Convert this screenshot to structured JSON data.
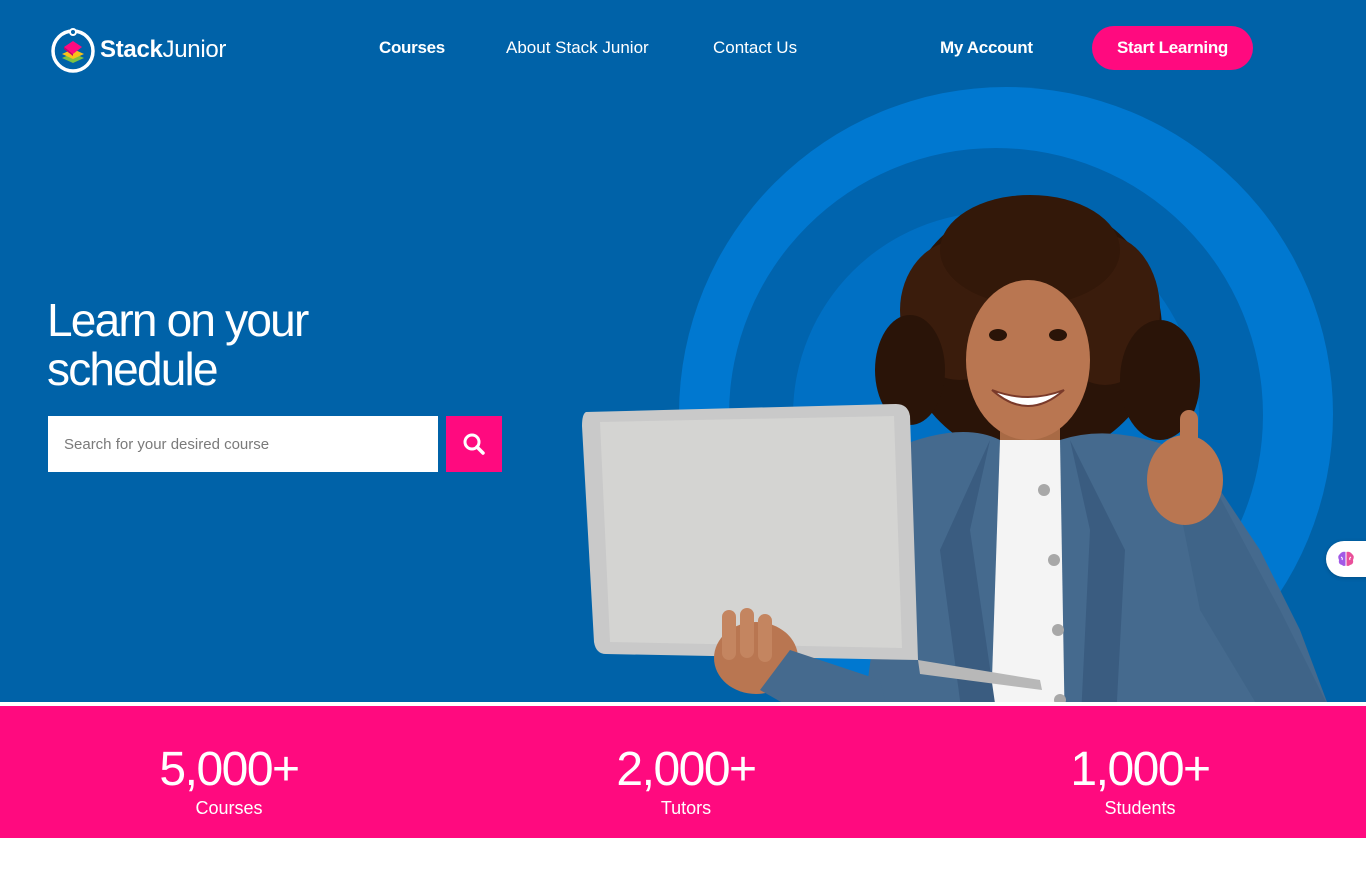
{
  "brand": {
    "name_bold": "Stack",
    "name_light": "Junior",
    "logo_icon": "stacked-books-logo-icon"
  },
  "nav": {
    "courses": "Courses",
    "about": "About Stack Junior",
    "contact": "Contact Us",
    "account": "My Account",
    "cta": "Start Learning"
  },
  "hero": {
    "headline": "Learn on your schedule",
    "search_placeholder": "Search for your desired course",
    "search_icon": "search-icon",
    "image": "student-with-laptop-thumbs-up"
  },
  "stats": [
    {
      "value": "5,000+",
      "label": "Courses"
    },
    {
      "value": "2,000+",
      "label": "Tutors"
    },
    {
      "value": "1,000+",
      "label": "Students"
    }
  ],
  "widget": {
    "icon": "brain-icon"
  },
  "colors": {
    "primary_blue": "#0062a8",
    "ring_blue": "#0078d0",
    "accent_pink": "#ff0a7f",
    "white": "#ffffff"
  }
}
